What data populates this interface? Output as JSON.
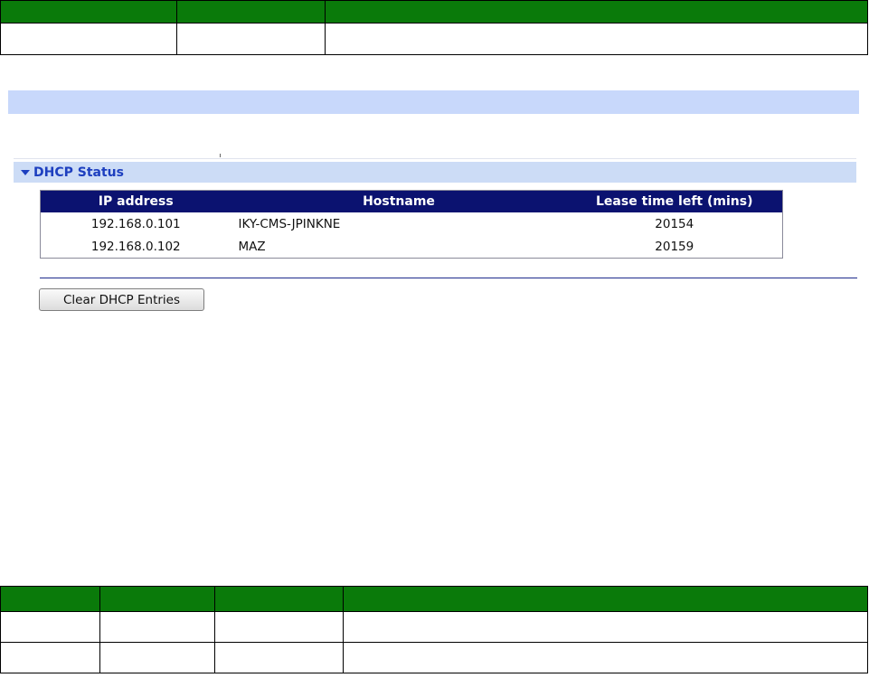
{
  "dhcp_status": {
    "section_title": "DHCP Status",
    "columns": {
      "ip": "IP address",
      "hostname": "Hostname",
      "lease": "Lease time left (mins)"
    },
    "rows": [
      {
        "ip": "192.168.0.101",
        "hostname": "IKY-CMS-JPINKNE",
        "lease": "20154"
      },
      {
        "ip": "192.168.0.102",
        "hostname": "MAZ",
        "lease": "20159"
      }
    ],
    "clear_button_label": "Clear DHCP Entries"
  },
  "colors": {
    "doc_table_header": "#0a7a0a",
    "section_band": "#c8d8fb",
    "section_title": "#1d3fbf",
    "table_header": "#0b1270"
  }
}
